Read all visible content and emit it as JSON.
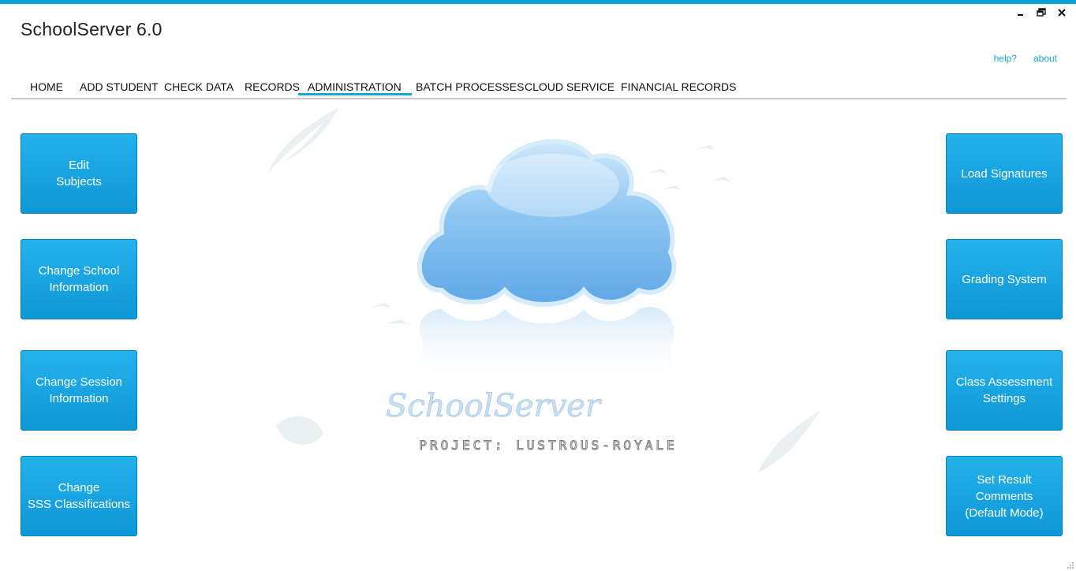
{
  "app": {
    "title": "SchoolServer 6.0"
  },
  "window_controls": {
    "minimize": "minimize-icon",
    "restore": "restore-icon",
    "close": "close-icon"
  },
  "links": {
    "help": "help?",
    "about": "about"
  },
  "nav": {
    "tabs": [
      {
        "label": "HOME"
      },
      {
        "label": "ADD STUDENT"
      },
      {
        "label": "CHECK DATA"
      },
      {
        "label": "RECORDS"
      },
      {
        "label": "ADMINISTRATION",
        "active": true
      },
      {
        "label": "BATCH PROCESSES"
      },
      {
        "label": "CLOUD SERVICE"
      },
      {
        "label": "FINANCIAL RECORDS"
      }
    ]
  },
  "left_buttons": [
    {
      "label": "Edit\nSubjects"
    },
    {
      "label": "Change School\nInformation"
    },
    {
      "label": "Change Session\nInformation"
    },
    {
      "label": "Change\nSSS Classifications"
    }
  ],
  "right_buttons": [
    {
      "label": "Load Signatures"
    },
    {
      "label": "Grading System"
    },
    {
      "label": "Class Assessment\nSettings"
    },
    {
      "label": "Set Result\nComments\n(Default Mode)"
    }
  ],
  "logo": {
    "script_text": "SchoolServer",
    "tagline": "PROJECT: LUSTROUS-ROYALE"
  },
  "colors": {
    "accent": "#1aa6dd",
    "tile": "#0e97d6",
    "topbar": "#0aa0d8"
  }
}
